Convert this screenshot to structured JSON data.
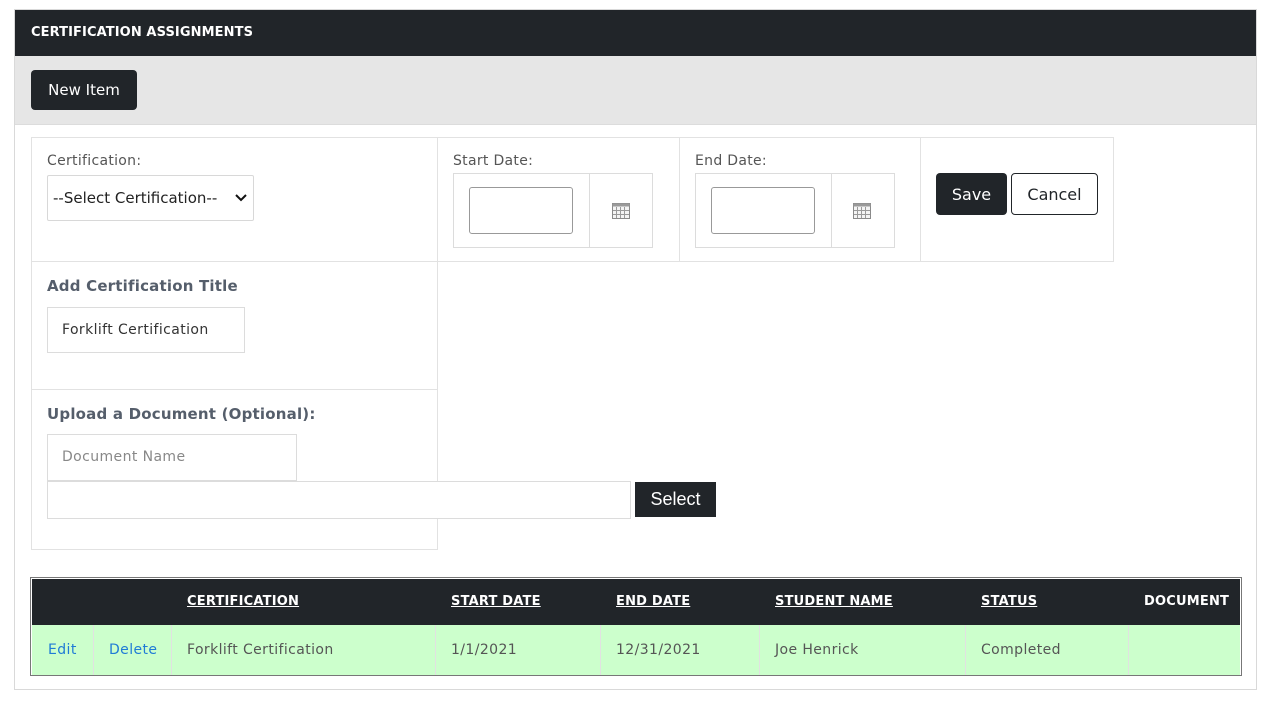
{
  "header": {
    "title": "CERTIFICATION ASSIGNMENTS"
  },
  "toolbar": {
    "new_item_label": "New Item"
  },
  "form": {
    "certification_label": "Certification:",
    "certification_selected": "--Select Certification--",
    "start_date_label": "Start Date:",
    "start_date_value": "",
    "end_date_label": "End Date:",
    "end_date_value": "",
    "save_label": "Save",
    "cancel_label": "Cancel",
    "title_label": "Add Certification Title",
    "title_value": "Forklift Certification",
    "upload_label": "Upload a Document (Optional):",
    "document_name_placeholder": "Document Name",
    "file_path_value": "",
    "select_label": "Select"
  },
  "grid": {
    "columns": [
      "CERTIFICATION",
      "START DATE",
      "END DATE",
      "STUDENT NAME",
      "STATUS",
      "DOCUMENT"
    ],
    "rows": [
      {
        "edit": "Edit",
        "delete": "Delete",
        "certification": "Forklift Certification",
        "start_date": "1/1/2021",
        "end_date": "12/31/2021",
        "student_name": "Joe Henrick",
        "status": "Completed",
        "document": ""
      }
    ]
  },
  "icons": {
    "calendar": "calendar-icon",
    "dropdown": "chevron-down-icon"
  },
  "colors": {
    "dark": "#212529",
    "row_highlight": "#ccffcc",
    "link": "#1f7bd6"
  }
}
